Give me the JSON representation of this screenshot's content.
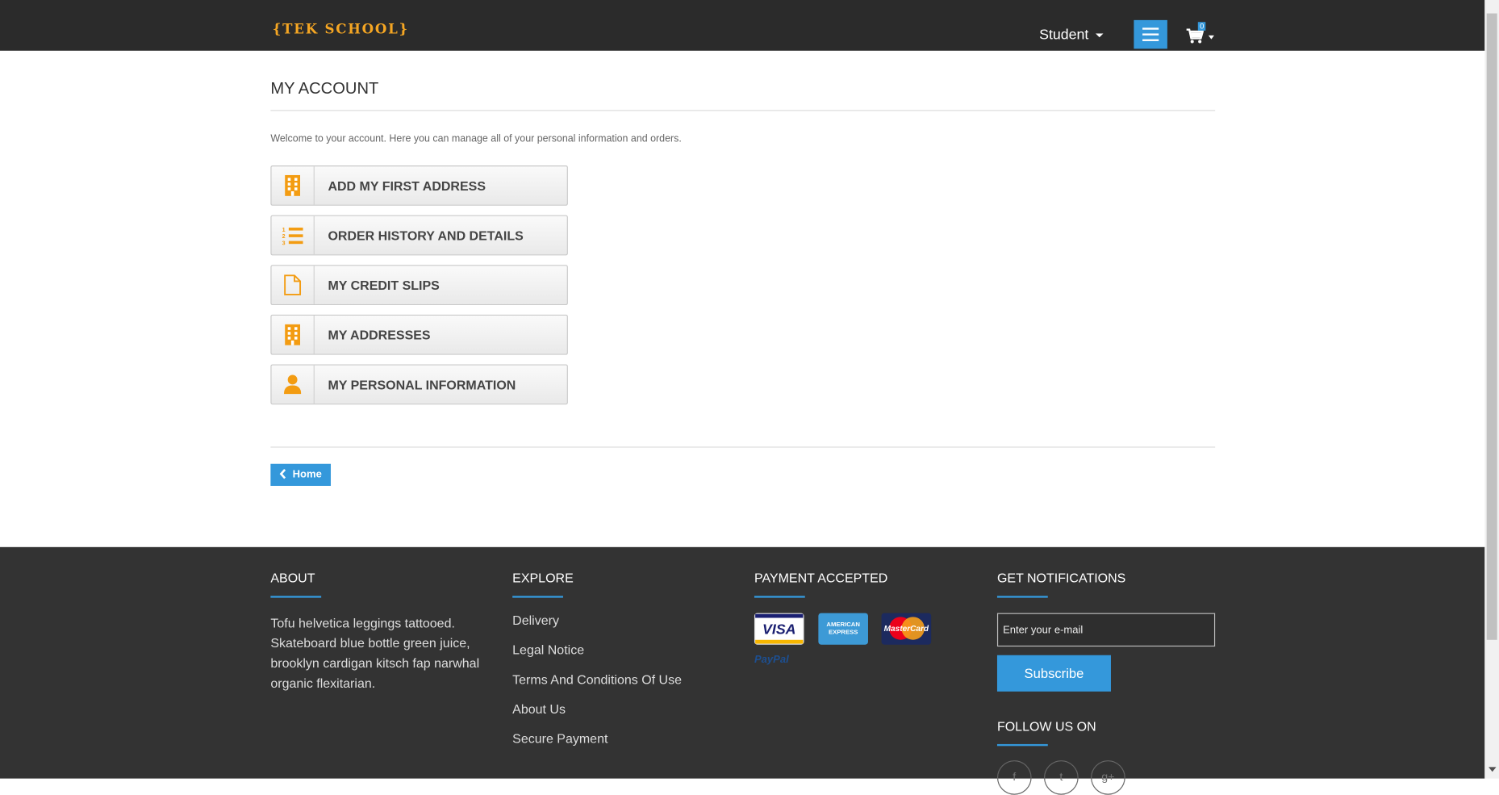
{
  "header": {
    "logo": "{TEK SCHOOL}",
    "user_menu": "Student",
    "menu_icon": "hamburger-icon",
    "cart_icon": "shopping-cart-icon",
    "cart_count": "0"
  },
  "main": {
    "title": "MY ACCOUNT",
    "welcome": "Welcome to your account. Here you can manage all of your personal information and orders.",
    "account_links": [
      {
        "label": "ADD MY FIRST ADDRESS",
        "icon": "building-icon"
      },
      {
        "label": "ORDER HISTORY AND DETAILS",
        "icon": "ordered-list-icon"
      },
      {
        "label": "MY CREDIT SLIPS",
        "icon": "document-icon"
      },
      {
        "label": "MY ADDRESSES",
        "icon": "building-icon"
      },
      {
        "label": "MY PERSONAL INFORMATION",
        "icon": "user-icon"
      }
    ],
    "home_button": "Home"
  },
  "footer": {
    "about": {
      "heading": "ABOUT",
      "text": "Tofu helvetica leggings tattooed. Skateboard blue bottle green juice, brooklyn cardigan kitsch fap narwhal organic flexitarian."
    },
    "explore": {
      "heading": "EXPLORE",
      "links": [
        "Delivery",
        "Legal Notice",
        "Terms And Conditions Of Use",
        "About Us",
        "Secure Payment"
      ]
    },
    "payment": {
      "heading": "PAYMENT ACCEPTED",
      "cards": [
        "VISA",
        "AMERICAN EXPRESS",
        "MasterCard",
        "PayPal"
      ]
    },
    "notifications": {
      "heading": "GET NOTIFICATIONS",
      "email_placeholder": "Enter your e-mail",
      "subscribe_label": "Subscribe",
      "follow_heading": "FOLLOW US ON",
      "social": [
        "facebook-icon",
        "twitter-icon",
        "google-plus-icon"
      ]
    }
  },
  "colors": {
    "accent": "#3498db",
    "logo": "#f5a623",
    "icon_orange": "#f39c12",
    "header_bg": "#2b2b2b",
    "footer_bg": "#333333"
  }
}
